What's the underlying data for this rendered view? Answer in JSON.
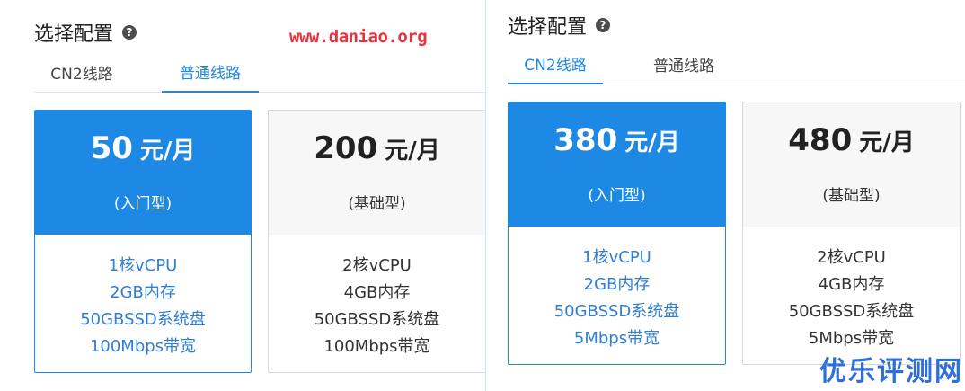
{
  "left": {
    "heading": "选择配置",
    "help_icon": "?",
    "tabs": [
      {
        "label": "CN2线路",
        "active": false
      },
      {
        "label": "普通线路",
        "active": true
      }
    ],
    "plans": [
      {
        "price": "50",
        "unit": "元/月",
        "tier": "(入门型)",
        "selected": true,
        "specs": [
          "1核vCPU",
          "2GB内存",
          "50GBSSD系统盘",
          "100Mbps带宽"
        ]
      },
      {
        "price": "200",
        "unit": "元/月",
        "tier": "(基础型)",
        "selected": false,
        "specs": [
          "2核vCPU",
          "4GB内存",
          "50GBSSD系统盘",
          "100Mbps带宽"
        ]
      }
    ]
  },
  "right": {
    "heading": "选择配置",
    "help_icon": "?",
    "tabs": [
      {
        "label": "CN2线路",
        "active": true
      },
      {
        "label": "普通线路",
        "active": false
      }
    ],
    "plans": [
      {
        "price": "380",
        "unit": "元/月",
        "tier": "(入门型)",
        "selected": true,
        "specs": [
          "1核vCPU",
          "2GB内存",
          "50GBSSD系统盘",
          "5Mbps带宽"
        ]
      },
      {
        "price": "480",
        "unit": "元/月",
        "tier": "(基础型)",
        "selected": false,
        "specs": [
          "2核vCPU",
          "4GB内存",
          "50GBSSD系统盘",
          "5Mbps带宽"
        ]
      }
    ]
  },
  "watermark_url": "www.daniao.org",
  "watermark_logo": "优乐评测网",
  "colors": {
    "accent": "#1e88e5",
    "watermark_red": "#e8323c",
    "logo_blue": "#2f6fd9"
  }
}
